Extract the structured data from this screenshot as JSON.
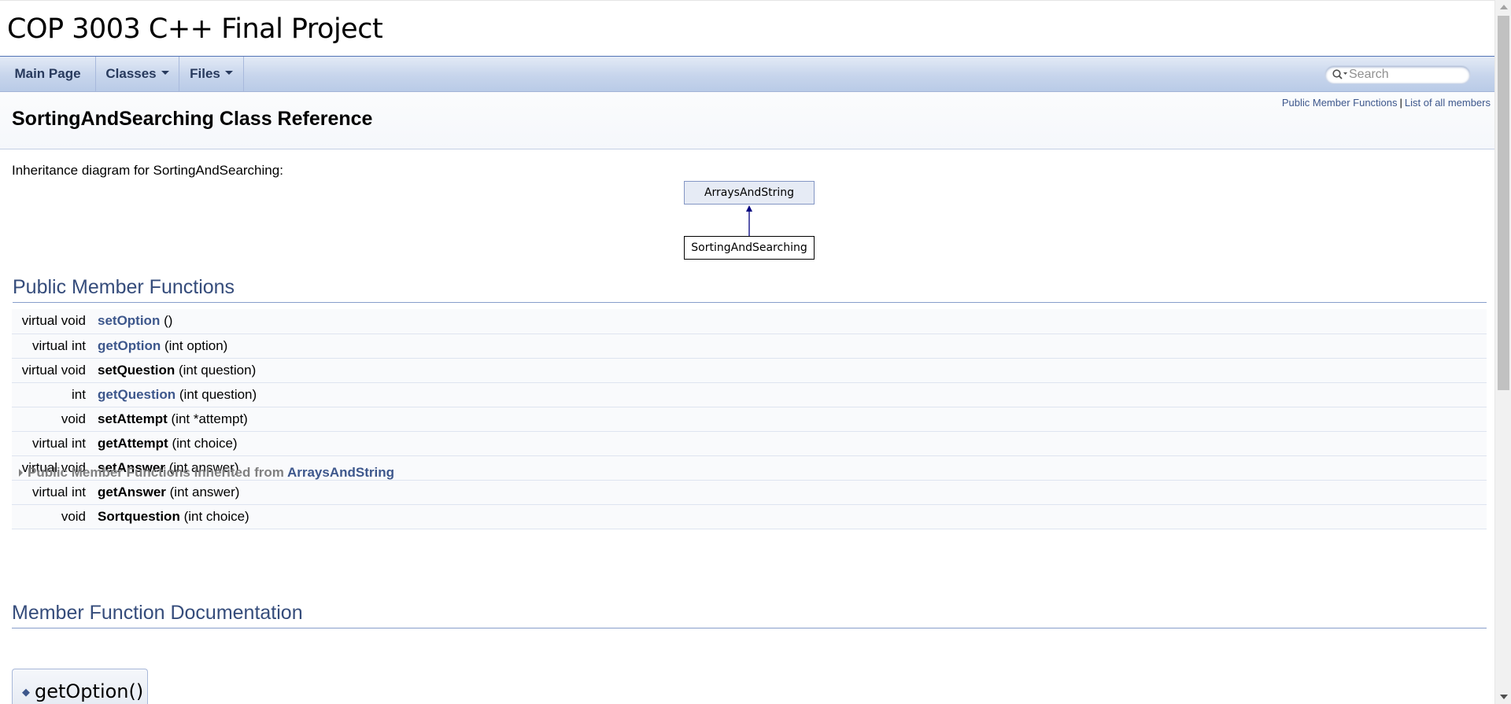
{
  "project": {
    "name": "COP 3003 C++ Final Project"
  },
  "nav": {
    "tabs": [
      {
        "label": "Main Page"
      },
      {
        "label": "Classes"
      },
      {
        "label": "Files"
      }
    ],
    "search": {
      "placeholder": "Search"
    }
  },
  "header": {
    "summary": {
      "public_member_functions": "Public Member Functions",
      "separator": "|",
      "list_all_members": "List of all members"
    },
    "title": "SortingAndSearching Class Reference"
  },
  "inheritance": {
    "caption": "Inheritance diagram for SortingAndSearching:",
    "base": "ArraysAndString",
    "derived": "SortingAndSearching"
  },
  "public_member_functions": {
    "heading": "Public Member Functions",
    "rows": [
      {
        "type": "virtual void",
        "name": "setOption",
        "args": " ()",
        "linked": true
      },
      {
        "type": "virtual int",
        "name": "getOption",
        "args": " (int option)",
        "linked": true
      },
      {
        "type": "virtual void",
        "name": "setQuestion",
        "args": " (int question)",
        "linked": false
      },
      {
        "type": "int",
        "name": "getQuestion",
        "args": " (int question)",
        "linked": true
      },
      {
        "type": "void",
        "name": "setAttempt",
        "args": " (int *attempt)",
        "linked": false
      },
      {
        "type": "virtual int",
        "name": "getAttempt",
        "args": " (int choice)",
        "linked": false
      },
      {
        "type": "virtual void",
        "name": "setAnswer",
        "args": " (int answer)",
        "linked": false
      },
      {
        "type": "virtual int",
        "name": "getAnswer",
        "args": " (int answer)",
        "linked": false
      },
      {
        "type": "void",
        "name": "Sortquestion",
        "args": " (int choice)",
        "linked": false
      }
    ],
    "inherited": {
      "prefix": "Public Member Functions inherited from ",
      "class": "ArraysAndString"
    }
  },
  "documentation": {
    "heading": "Member Function Documentation",
    "first_member": "getOption()",
    "marker": "◆"
  },
  "colors": {
    "link": "#3d578c",
    "heading": "#354c7b",
    "nav_text": "#283a5d"
  }
}
